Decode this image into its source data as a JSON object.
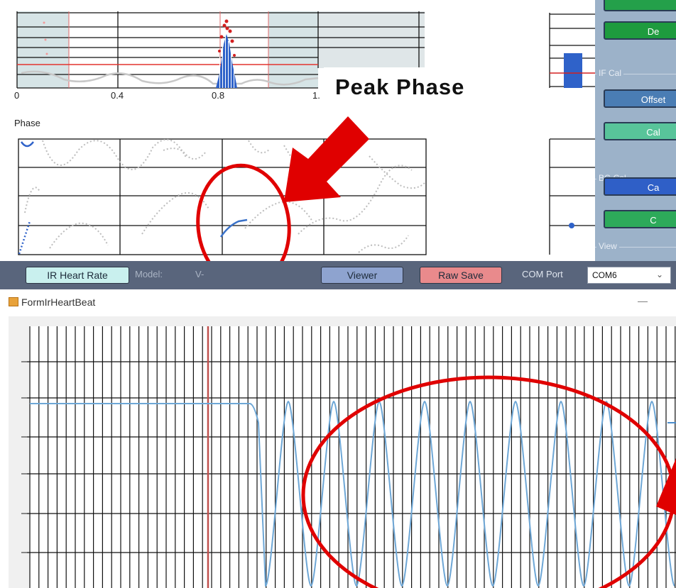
{
  "top": {
    "ticks": [
      "0",
      "0.4",
      "0.8",
      "1."
    ],
    "phase_label": "Phase",
    "callout": "Peak Phase"
  },
  "side": {
    "btn_de": "De",
    "if_cal": "IF Cal",
    "btn_offset": "Offset",
    "btn_cal1": "Cal",
    "bg_cal": "BG Cal",
    "btn_ca": "Ca",
    "btn_c": "C",
    "view": "View"
  },
  "toolbar": {
    "ir_btn": "IR Heart Rate",
    "model_label": "Model:",
    "model_value": "V-",
    "viewer": "Viewer",
    "raw_save": "Raw Save",
    "com_port_label": "COM Port",
    "com_port_value": "COM6"
  },
  "window": {
    "title": "FormIrHeartBeat",
    "minimize": "—"
  },
  "colors": {
    "annotation_red": "#e00000",
    "signal_blue": "#5e9fd2",
    "toolbar_bg": "#59657c",
    "panel_bg": "#9cb2c9"
  }
}
